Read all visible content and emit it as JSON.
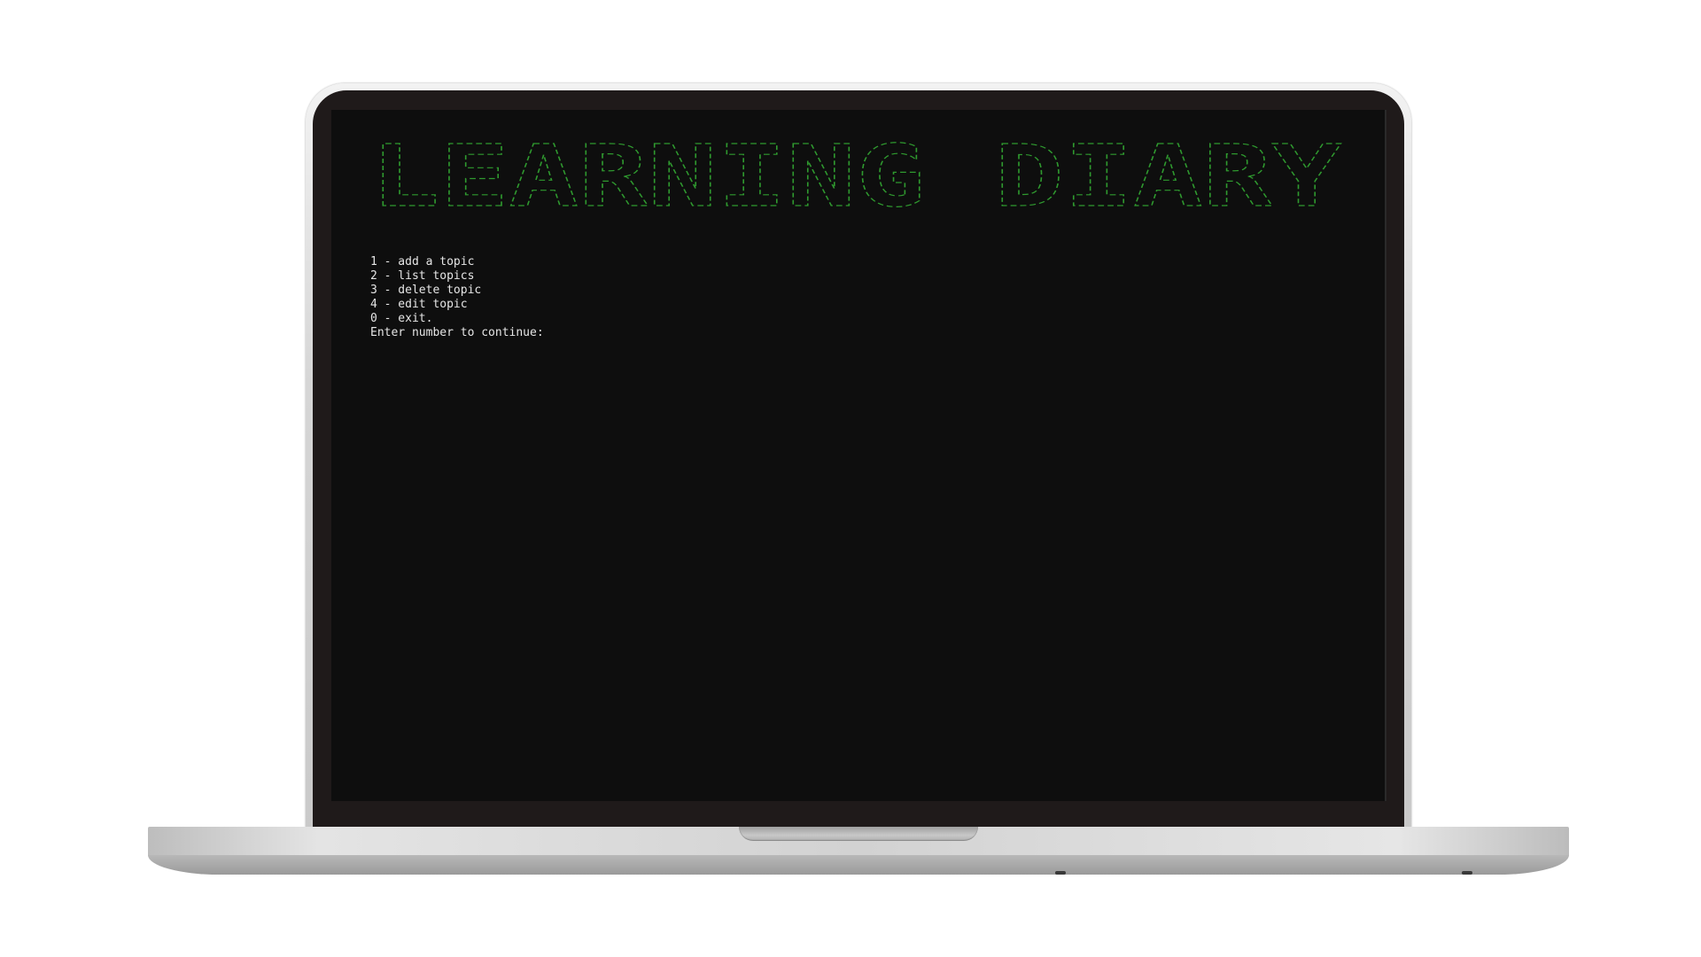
{
  "terminal": {
    "banner_text": "LEARNING DIARY",
    "banner_color": "#2f9a2f",
    "text_color": "#e6e6e6",
    "background_color": "#0e0e0e",
    "menu": [
      "1 - add a topic",
      "2 - list topics",
      "3 - delete topic",
      "4 - edit topic",
      "0 - exit."
    ],
    "prompt": "Enter number to continue:"
  }
}
